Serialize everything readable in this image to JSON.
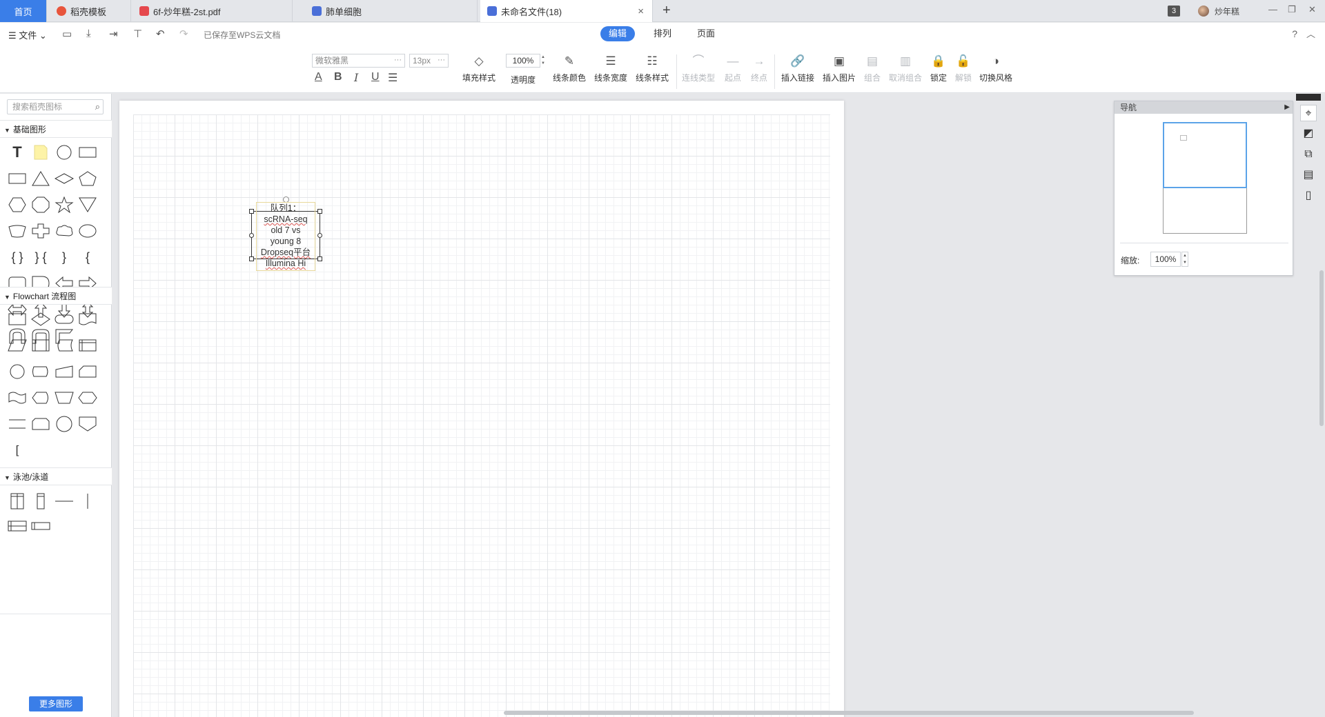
{
  "tabs": {
    "home": "首页",
    "items": [
      {
        "label": "稻壳模板"
      },
      {
        "label": "6f-炒年糕-2st.pdf"
      },
      {
        "label": "肺单细胞"
      },
      {
        "label": "未命名文件(18)"
      }
    ],
    "new_tab": "+",
    "close": "×"
  },
  "user": {
    "badge": "3",
    "name": "炒年糕"
  },
  "window": {
    "minimize": "—",
    "restore": "❐",
    "close": "✕"
  },
  "menubar": {
    "file": "☰ 文件 ⌄",
    "saved_status": "已保存至WPS云文档",
    "modes": [
      "编辑",
      "排列",
      "页面"
    ],
    "active_mode": "编辑",
    "help": "?",
    "collapse": "︿"
  },
  "format": {
    "font": "微软雅黑",
    "size": "13px",
    "dots": "···"
  },
  "tools": [
    {
      "icon": "◇",
      "label": "填充样式",
      "disabled": false
    },
    {
      "icon": "✎",
      "label": "线条颜色",
      "disabled": false
    },
    {
      "icon": "☰",
      "label": "线条宽度",
      "disabled": false
    },
    {
      "icon": "☷",
      "label": "线条样式",
      "disabled": false
    },
    {
      "icon": "⌒",
      "label": "连线类型",
      "disabled": true
    },
    {
      "icon": "—",
      "label": "起点",
      "disabled": true
    },
    {
      "icon": "→",
      "label": "终点",
      "disabled": true
    },
    {
      "icon": "🔗",
      "label": "插入链接",
      "disabled": false
    },
    {
      "icon": "▣",
      "label": "插入图片",
      "disabled": false
    },
    {
      "icon": "▤",
      "label": "组合",
      "disabled": true
    },
    {
      "icon": "▥",
      "label": "取消组合",
      "disabled": true
    },
    {
      "icon": "🔒",
      "label": "锁定",
      "disabled": false
    },
    {
      "icon": "🔓",
      "label": "解锁",
      "disabled": true
    },
    {
      "icon": "◑",
      "label": "切换风格",
      "disabled": false
    }
  ],
  "opacity": {
    "value": "100%",
    "label": "透明度"
  },
  "left_panel": {
    "search_placeholder": "搜索稻壳图标",
    "sections": [
      "基础图形",
      "Flowchart 流程图",
      "泳池/泳道"
    ],
    "more_button": "更多图形"
  },
  "canvas": {
    "shape_text": [
      "队列1：",
      "scRNA-seq",
      "old 7 vs",
      "young 8",
      "Dropseq平台",
      "Illumina Hi"
    ]
  },
  "navigator": {
    "title": "导航",
    "zoom_label": "缩放:",
    "zoom_value": "100%"
  }
}
